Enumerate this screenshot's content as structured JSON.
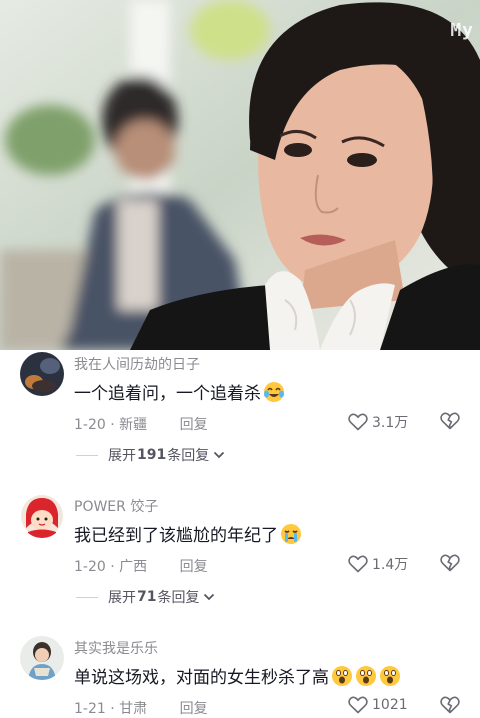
{
  "video": {
    "watermark": "My",
    "description_icon": "video-frame"
  },
  "comments": [
    {
      "username": "我在人间历劫的日子",
      "text": "一个追着问，一个追着杀",
      "emoji": [
        "crying-laughing-emoji"
      ],
      "date_location": "1-20 · 新疆",
      "reply_label": "回复",
      "likes": "3.1万",
      "expand": {
        "prefix": "展开",
        "count": "191",
        "suffix": "条回复"
      }
    },
    {
      "username": "POWER 饺子",
      "text": "我已经到了该尴尬的年纪了",
      "emoji": [
        "crying-emoji"
      ],
      "date_location": "1-20 · 广西",
      "reply_label": "回复",
      "likes": "1.4万",
      "expand": {
        "prefix": "展开",
        "count": "71",
        "suffix": "条回复"
      }
    },
    {
      "username": "其实我是乐乐",
      "text": "单说这场戏，对面的女生秒杀了高",
      "emoji": [
        "shocked-emoji",
        "shocked-emoji",
        "shocked-emoji"
      ],
      "date_location": "1-21 · 甘肃",
      "reply_label": "回复",
      "likes": "1021"
    }
  ],
  "colors": {
    "text_primary": "#161823",
    "text_secondary": "#8a8b91",
    "divider": "#d0d1d5"
  }
}
